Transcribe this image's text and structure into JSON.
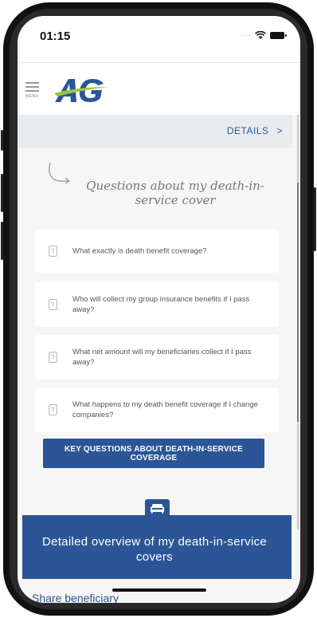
{
  "status_bar": {
    "time": "01:15",
    "signal_dots": "·····"
  },
  "header": {
    "menu_label": "MENU",
    "logo_alt": "AG logo",
    "colors": {
      "brand_blue": "#2b5596",
      "logo_green": "#9dc53b"
    }
  },
  "details_bar": {
    "label": "DETAILS",
    "chevron": ">"
  },
  "questions_section": {
    "heading": "Questions about my death-in-service cover",
    "items": [
      {
        "text": "What exactly is death benefit coverage?"
      },
      {
        "text": "Who will collect my group insurance benefits if I pass away?"
      },
      {
        "text": "What net amount will my beneficiaries collect if I pass away?"
      },
      {
        "text": "What happens to my death benefit coverage if I change companies?"
      }
    ],
    "button_label": "KEY QUESTIONS ABOUT DEATH-IN-SERVICE COVERAGE"
  },
  "overview": {
    "title": "Detailed overview of my death-in-service covers",
    "icon": "sofa-icon"
  },
  "cutoff_text": "Share beneficiary"
}
